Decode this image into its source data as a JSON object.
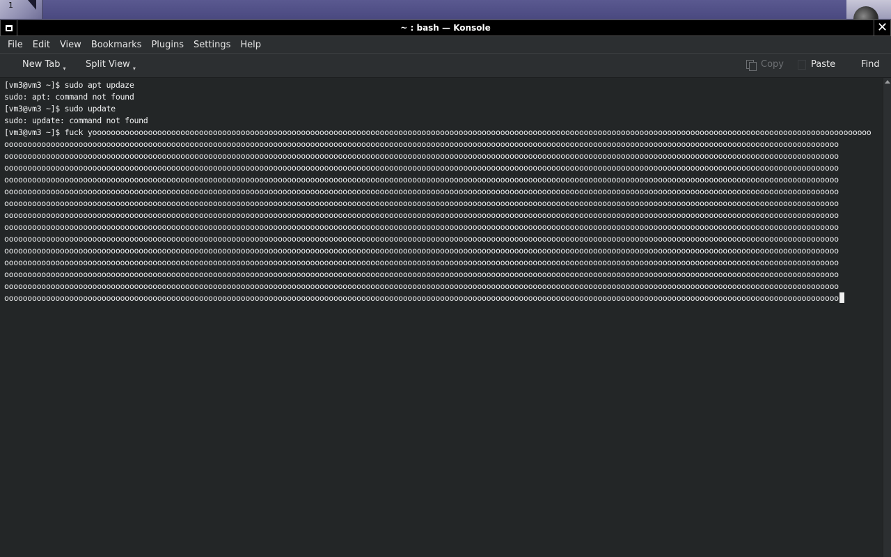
{
  "desktop": {
    "pager_label": "1"
  },
  "window": {
    "title": "~ : bash — Konsole"
  },
  "menu": {
    "items": [
      "File",
      "Edit",
      "View",
      "Bookmarks",
      "Plugins",
      "Settings",
      "Help"
    ]
  },
  "toolbar": {
    "new_tab_label": "New Tab",
    "split_view_label": "Split View",
    "copy_label": "Copy",
    "paste_label": "Paste",
    "find_label": "Find"
  },
  "terminal": {
    "lines": [
      "[vm3@vm3 ~]$ sudo apt updaze",
      "sudo: apt: command not found",
      "[vm3@vm3 ~]$ sudo update",
      "sudo: update: command not found",
      "[vm3@vm3 ~]$ fuck yoooooooooooooooooooooooooooooooooooooooooooooooooooooooooooooooooooooooooooooooooooooooooooooooooooooooooooooooooooooooooooooooooooooooooooooooooooooooooooooooooooooooo",
      "oooooooooooooooooooooooooooooooooooooooooooooooooooooooooooooooooooooooooooooooooooooooooooooooooooooooooooooooooooooooooooooooooooooooooooooooooooooooooooooooooooooooooooooooooooo",
      "oooooooooooooooooooooooooooooooooooooooooooooooooooooooooooooooooooooooooooooooooooooooooooooooooooooooooooooooooooooooooooooooooooooooooooooooooooooooooooooooooooooooooooooooooooo",
      "oooooooooooooooooooooooooooooooooooooooooooooooooooooooooooooooooooooooooooooooooooooooooooooooooooooooooooooooooooooooooooooooooooooooooooooooooooooooooooooooooooooooooooooooooooo",
      "oooooooooooooooooooooooooooooooooooooooooooooooooooooooooooooooooooooooooooooooooooooooooooooooooooooooooooooooooooooooooooooooooooooooooooooooooooooooooooooooooooooooooooooooooooo",
      "oooooooooooooooooooooooooooooooooooooooooooooooooooooooooooooooooooooooooooooooooooooooooooooooooooooooooooooooooooooooooooooooooooooooooooooooooooooooooooooooooooooooooooooooooooo",
      "oooooooooooooooooooooooooooooooooooooooooooooooooooooooooooooooooooooooooooooooooooooooooooooooooooooooooooooooooooooooooooooooooooooooooooooooooooooooooooooooooooooooooooooooooooo",
      "oooooooooooooooooooooooooooooooooooooooooooooooooooooooooooooooooooooooooooooooooooooooooooooooooooooooooooooooooooooooooooooooooooooooooooooooooooooooooooooooooooooooooooooooooooo",
      "oooooooooooooooooooooooooooooooooooooooooooooooooooooooooooooooooooooooooooooooooooooooooooooooooooooooooooooooooooooooooooooooooooooooooooooooooooooooooooooooooooooooooooooooooooo",
      "oooooooooooooooooooooooooooooooooooooooooooooooooooooooooooooooooooooooooooooooooooooooooooooooooooooooooooooooooooooooooooooooooooooooooooooooooooooooooooooooooooooooooooooooooooo",
      "oooooooooooooooooooooooooooooooooooooooooooooooooooooooooooooooooooooooooooooooooooooooooooooooooooooooooooooooooooooooooooooooooooooooooooooooooooooooooooooooooooooooooooooooooooo",
      "oooooooooooooooooooooooooooooooooooooooooooooooooooooooooooooooooooooooooooooooooooooooooooooooooooooooooooooooooooooooooooooooooooooooooooooooooooooooooooooooooooooooooooooooooooo",
      "oooooooooooooooooooooooooooooooooooooooooooooooooooooooooooooooooooooooooooooooooooooooooooooooooooooooooooooooooooooooooooooooooooooooooooooooooooooooooooooooooooooooooooooooooooo",
      "oooooooooooooooooooooooooooooooooooooooooooooooooooooooooooooooooooooooooooooooooooooooooooooooooooooooooooooooooooooooooooooooooooooooooooooooooooooooooooooooooooooooooooooooooooo",
      "oooooooooooooooooooooooooooooooooooooooooooooooooooooooooooooooooooooooooooooooooooooooooooooooooooooooooooooooooooooooooooooooooooooooooooooooooooooooooooooooooooooooooooooooooooo",
      "ooooooooooooooooooooooooooooooooooooooooooooooooooooooooooooooooooooooooooooooooooooooooooooooooooooooooooooooooooooooooooooooooooooooooooooooooooooooooooooooooooooooooooooooooooo"
    ]
  }
}
